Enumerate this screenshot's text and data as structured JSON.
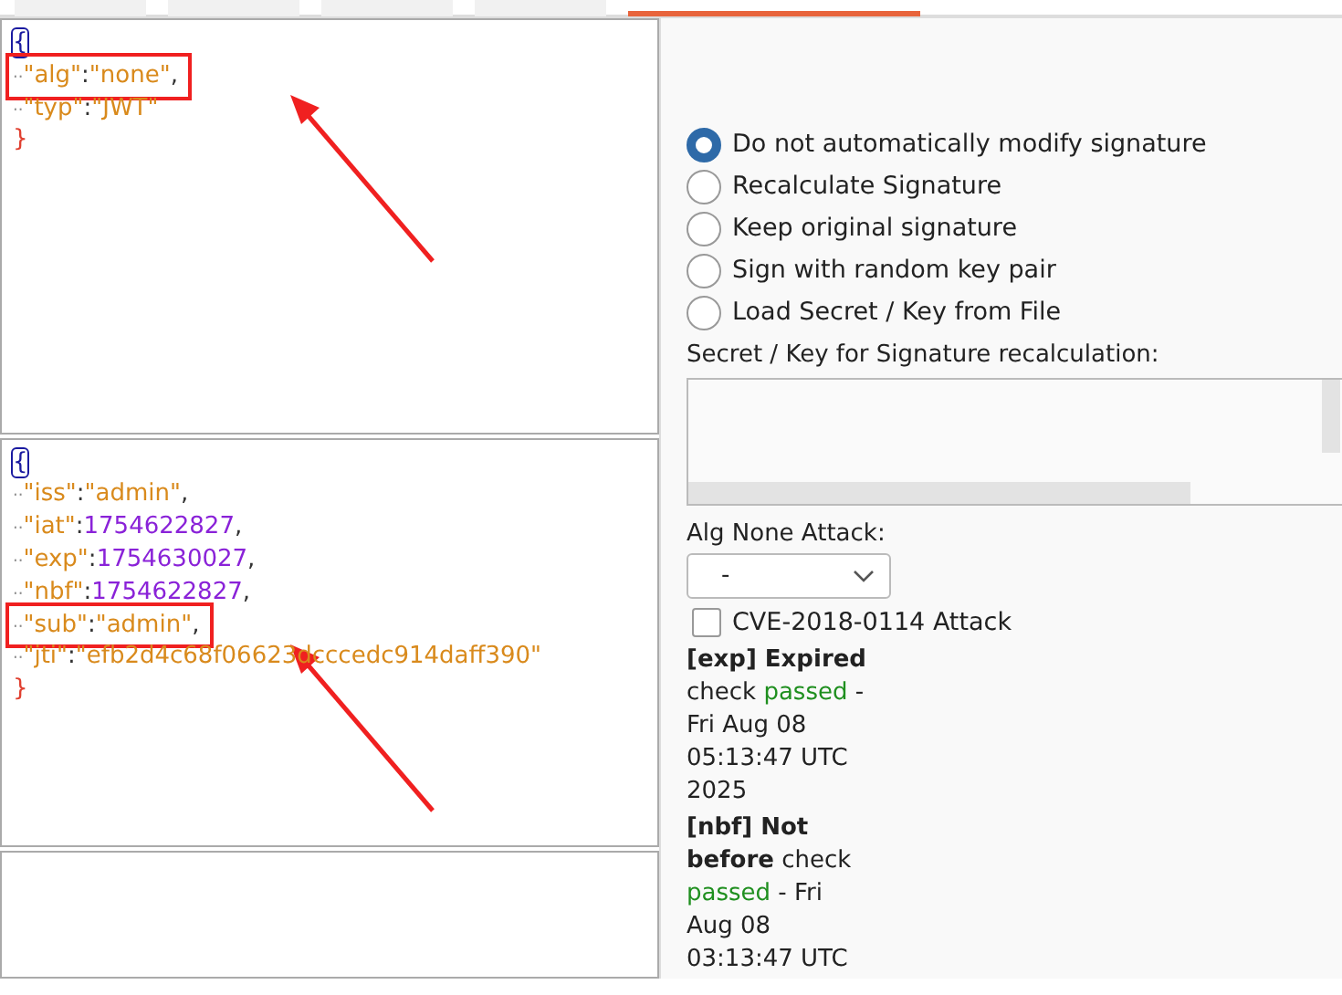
{
  "tabs": [
    {
      "selected": false
    },
    {
      "selected": false
    },
    {
      "selected": false
    },
    {
      "selected": false
    },
    {
      "selected": true
    }
  ],
  "header_editor": {
    "lines": [
      {
        "kind": "brace",
        "text": "{",
        "cursor": true
      },
      {
        "kind": "string",
        "indent": "··",
        "key": "\"alg\"",
        "sep": ":",
        "value": "\"none\"",
        "trail": ",",
        "highlighted": true
      },
      {
        "kind": "string",
        "indent": "··",
        "key": "\"typ\"",
        "sep": ":",
        "value": "\"JWT\"",
        "highlighted": false
      },
      {
        "kind": "brace",
        "text": "}",
        "cursor": false
      }
    ]
  },
  "payload_editor": {
    "lines": [
      {
        "kind": "brace",
        "text": "{",
        "cursor": true
      },
      {
        "kind": "string",
        "indent": "··",
        "key": "\"iss\"",
        "sep": ":",
        "value": "\"admin\"",
        "trail": ",",
        "highlighted": false
      },
      {
        "kind": "number",
        "indent": "··",
        "key": "\"iat\"",
        "sep": ":",
        "value": "1754622827",
        "trail": ",",
        "highlighted": false
      },
      {
        "kind": "number",
        "indent": "··",
        "key": "\"exp\"",
        "sep": ":",
        "value": "1754630027",
        "trail": ",",
        "highlighted": false
      },
      {
        "kind": "number",
        "indent": "··",
        "key": "\"nbf\"",
        "sep": ":",
        "value": "1754622827",
        "trail": ",",
        "highlighted": false
      },
      {
        "kind": "string",
        "indent": "··",
        "key": "\"sub\"",
        "sep": ":",
        "value": "\"admin\"",
        "trail": ",",
        "highlighted": true
      },
      {
        "kind": "string",
        "indent": "··",
        "key": "\"jti\"",
        "sep": ":",
        "value": "\"efb2d4c68f06623dcccedc914daff390\"",
        "highlighted": false
      },
      {
        "kind": "brace",
        "text": "}",
        "cursor": false
      }
    ]
  },
  "signature_options": [
    {
      "label": "Do not automatically modify signature",
      "selected": true
    },
    {
      "label": "Recalculate Signature",
      "selected": false
    },
    {
      "label": "Keep original signature",
      "selected": false
    },
    {
      "label": "Sign with random key pair",
      "selected": false
    },
    {
      "label": "Load Secret / Key from File",
      "selected": false
    }
  ],
  "secret_label": "Secret / Key for Signature recalculation:",
  "alg_none": {
    "label": "Alg None Attack:",
    "value": "-"
  },
  "cve_attack": {
    "label": "CVE-2018-0114 Attack",
    "checked": false
  },
  "checks": [
    [
      {
        "text": "[exp] Expired",
        "kind": "bold"
      },
      {
        "text": " check ",
        "kind": "plain"
      },
      {
        "text": "passed",
        "kind": "ok"
      },
      {
        "text": " - Fri Aug 08 05:13:47 UTC 2025",
        "kind": "plain"
      }
    ],
    [
      {
        "text": "[nbf] Not before",
        "kind": "bold"
      },
      {
        "text": " check ",
        "kind": "plain"
      },
      {
        "text": "passed",
        "kind": "ok"
      },
      {
        "text": " - Fri Aug 08 03:13:47 UTC",
        "kind": "plain"
      }
    ]
  ]
}
